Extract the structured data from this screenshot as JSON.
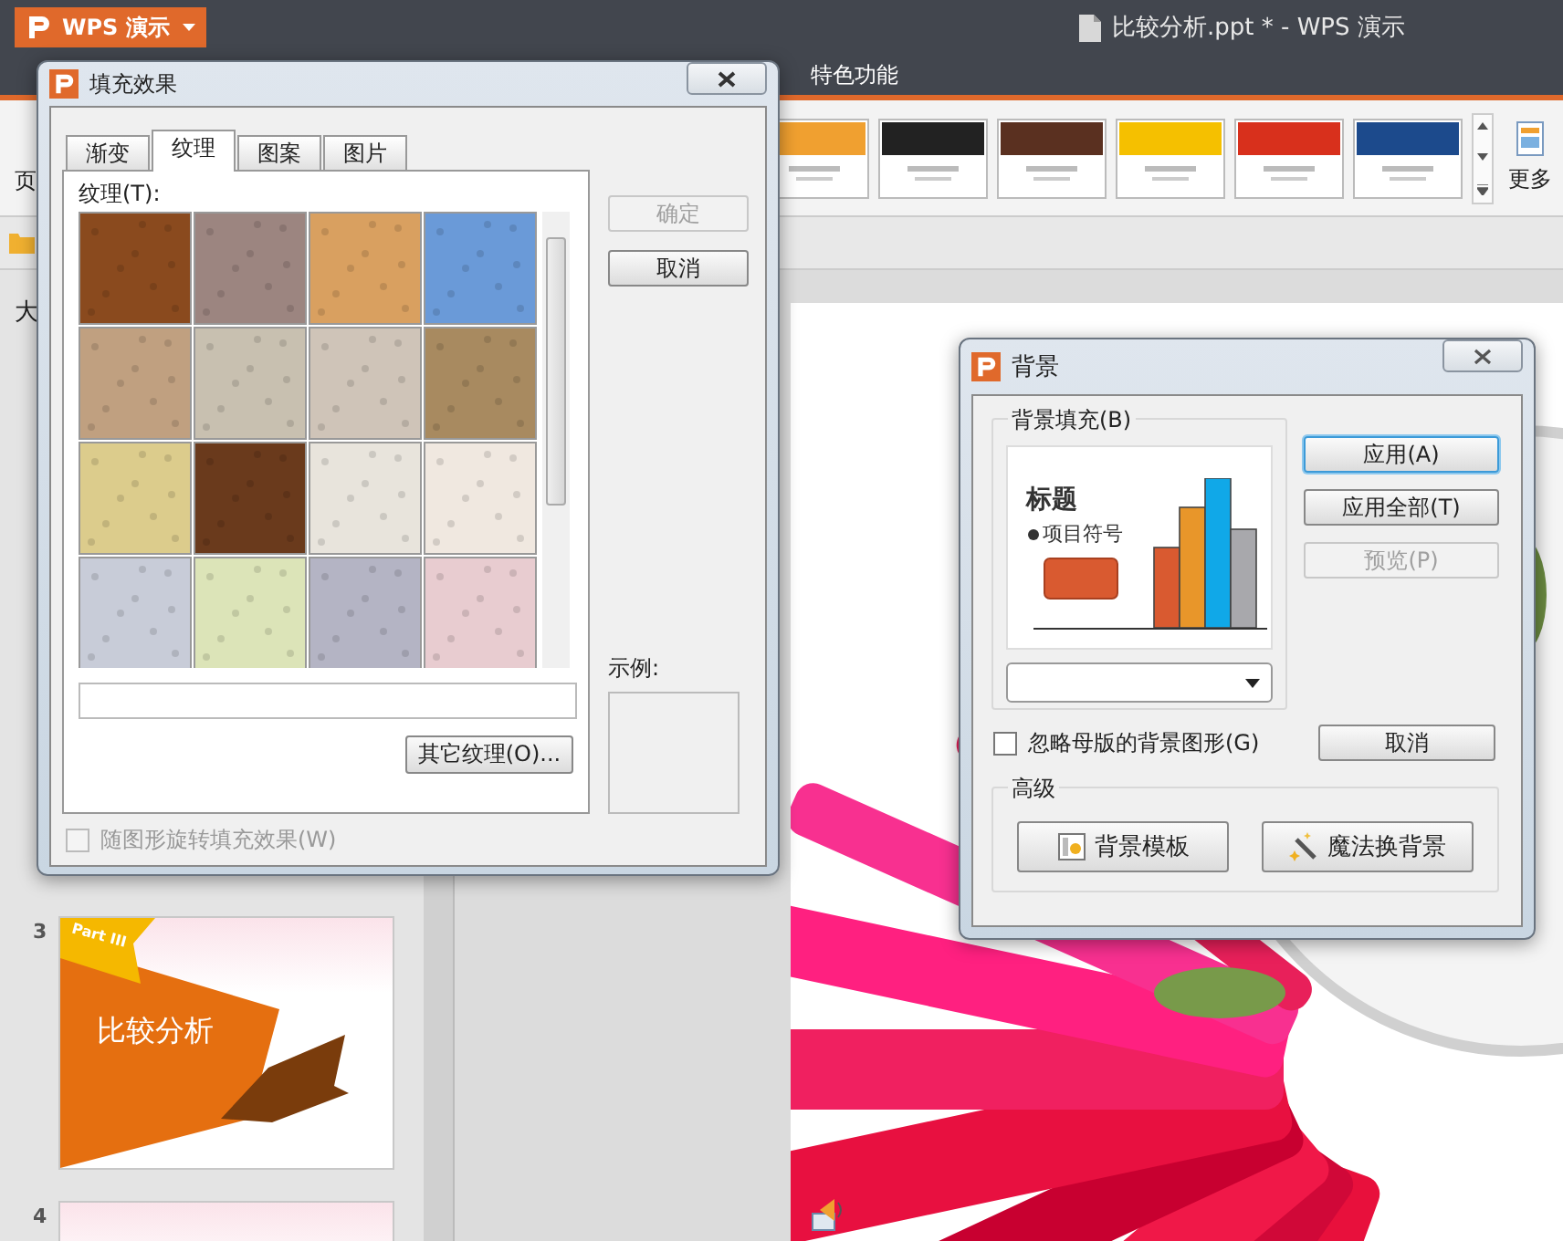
{
  "app": {
    "name": "WPS 演示",
    "doc_title": "比较分析.ppt * - WPS 演示"
  },
  "menu_tabs": [
    {
      "label": "特色功能",
      "selected": false
    }
  ],
  "ribbon": {
    "group_label": "页",
    "templates": [
      {
        "color": "#f0a030"
      },
      {
        "color": "#222222"
      },
      {
        "color": "#5a3020"
      },
      {
        "color": "#f5c000"
      },
      {
        "color": "#d8301c"
      },
      {
        "color": "#1c4a8c"
      }
    ],
    "more_label": "更多"
  },
  "slide_pane": {
    "tab_label": "大",
    "slides": [
      {
        "number": "3",
        "title": "比较分析",
        "tag": "Part III"
      },
      {
        "number": "4"
      }
    ]
  },
  "fill_dialog": {
    "title": "填充效果",
    "tabs": [
      {
        "label": "渐变",
        "selected": false
      },
      {
        "label": "纹理",
        "selected": true
      },
      {
        "label": "图案",
        "selected": false
      },
      {
        "label": "图片",
        "selected": false
      }
    ],
    "texture_label": "纹理(T):",
    "textures": [
      {
        "color": "#8a4a1e"
      },
      {
        "color": "#9c8580"
      },
      {
        "color": "#d9a060"
      },
      {
        "color": "#6a9ad8"
      },
      {
        "color": "#c0a080"
      },
      {
        "color": "#c8c0b0"
      },
      {
        "color": "#cfc4b8"
      },
      {
        "color": "#a88a60"
      },
      {
        "color": "#dccc8c"
      },
      {
        "color": "#6a3a1c"
      },
      {
        "color": "#e8e4dc"
      },
      {
        "color": "#f0e8e0"
      },
      {
        "color": "#c8ccd8"
      },
      {
        "color": "#dce4b8"
      },
      {
        "color": "#b4b4c4"
      },
      {
        "color": "#e8ccd0"
      }
    ],
    "other_button": "其它纹理(O)...",
    "buttons": [
      {
        "label": "确定",
        "disabled": true
      },
      {
        "label": "取消",
        "disabled": false
      }
    ],
    "sample_label": "示例:",
    "rotate_option": {
      "label": "随图形旋转填充效果(W)",
      "checked": false,
      "disabled": true
    }
  },
  "background_dialog": {
    "title": "背景",
    "fill_group": {
      "label": "背景填充(B)",
      "preview_title": "标题",
      "preview_bullet": "项目符号"
    },
    "buttons": [
      {
        "label": "应用(A)",
        "disabled": false,
        "focused": true
      },
      {
        "label": "应用全部(T)",
        "disabled": false,
        "focused": false
      },
      {
        "label": "预览(P)",
        "disabled": true,
        "focused": false
      }
    ],
    "ignore_master": {
      "label": "忽略母版的背景图形(G)",
      "checked": false
    },
    "cancel_label": "取消",
    "advanced": {
      "label": "高级",
      "buttons": [
        {
          "label": "背景模板",
          "kind": "template"
        },
        {
          "label": "魔法换背景",
          "kind": "magic"
        }
      ]
    }
  }
}
